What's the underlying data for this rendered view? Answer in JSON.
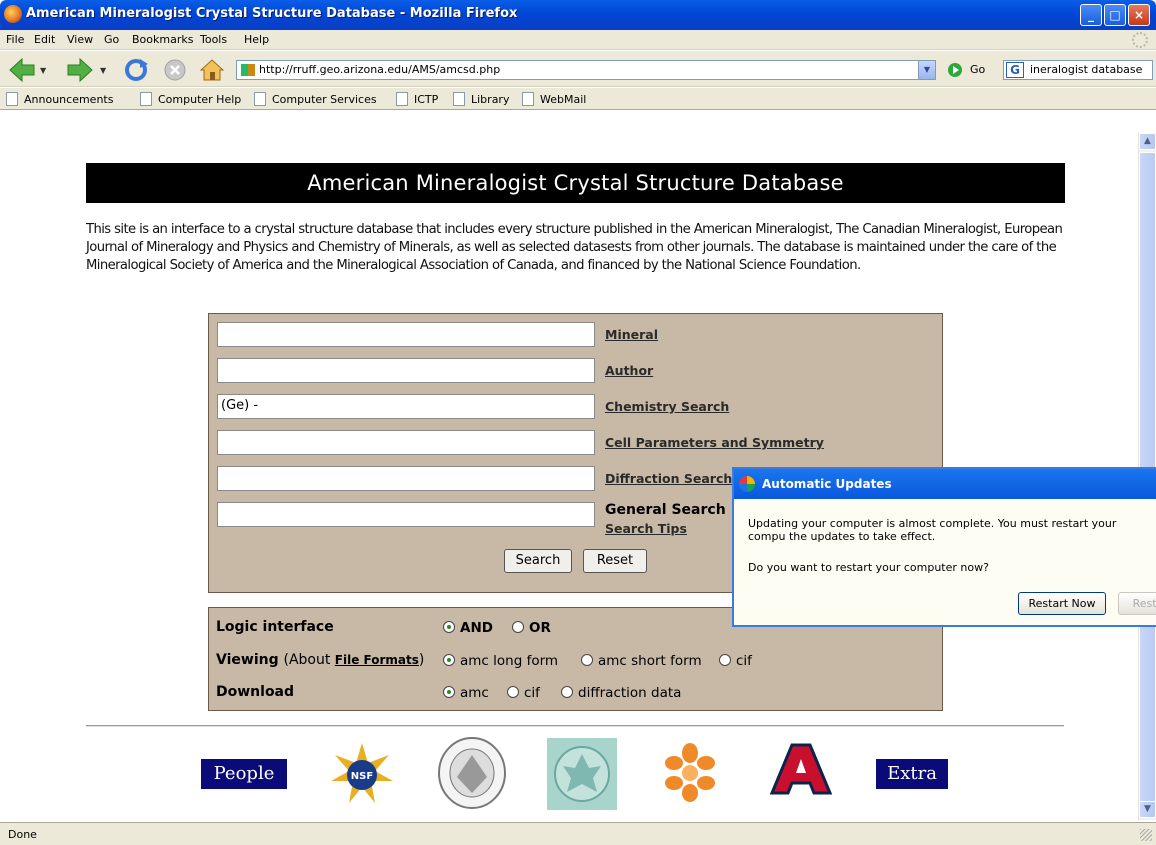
{
  "window": {
    "title": "American Mineralogist Crystal Structure Database - Mozilla Firefox",
    "controls": [
      "_",
      "□",
      "×"
    ]
  },
  "menubar": [
    "File",
    "Edit",
    "View",
    "Go",
    "Bookmarks",
    "Tools",
    "Help"
  ],
  "toolbar": {
    "url": "http://rruff.geo.arizona.edu/AMS/amcsd.php",
    "go_label": "Go",
    "search_value": "ineralogist database"
  },
  "bookmarks": [
    "Announcements",
    "Computer Help",
    "Computer Services",
    "ICTP",
    "Library",
    "WebMail"
  ],
  "page": {
    "banner": "American Mineralogist Crystal Structure Database",
    "intro": "This site is an interface to a crystal structure database that includes every structure published in the American Mineralogist, The Canadian Mineralogist, European Journal of Mineralogy and Physics and Chemistry of Minerals, as well as selected datasests from other journals. The database is maintained under the care of the Mineralogical Society of America and the Mineralogical Association of Canada, and financed by the National Science Foundation.",
    "fields": [
      {
        "value": "",
        "label": "Mineral"
      },
      {
        "value": "",
        "label": "Author"
      },
      {
        "value": "(Ge) -",
        "label": "Chemistry Search"
      },
      {
        "value": "",
        "label": "Cell Parameters and Symmetry"
      },
      {
        "value": "",
        "label": "Diffraction Search"
      },
      {
        "value": "",
        "label": "General Search"
      }
    ],
    "search_tips": "Search Tips",
    "search_button": "Search",
    "reset_button": "Reset",
    "options": {
      "logic": {
        "label": "Logic interface",
        "choices": [
          "AND",
          "OR"
        ],
        "selected": "AND"
      },
      "viewing": {
        "label": "Viewing",
        "about_prefix": "(About ",
        "about_link": "File Formats",
        "about_suffix": ")",
        "choices": [
          "amc long form",
          "amc short form",
          "cif"
        ],
        "selected": "amc long form"
      },
      "download": {
        "label": "Download",
        "choices": [
          "amc",
          "cif",
          "diffraction data"
        ],
        "selected": "amc"
      }
    },
    "footer": {
      "people": "People",
      "extra": "Extra"
    }
  },
  "status": "Done",
  "popup": {
    "title": "Automatic Updates",
    "body": "Updating your computer is almost complete. You must restart your compu the updates to take effect.",
    "question": "Do you want to restart your computer now?",
    "restart_button": "Restart Now",
    "later_button": "Resta"
  }
}
